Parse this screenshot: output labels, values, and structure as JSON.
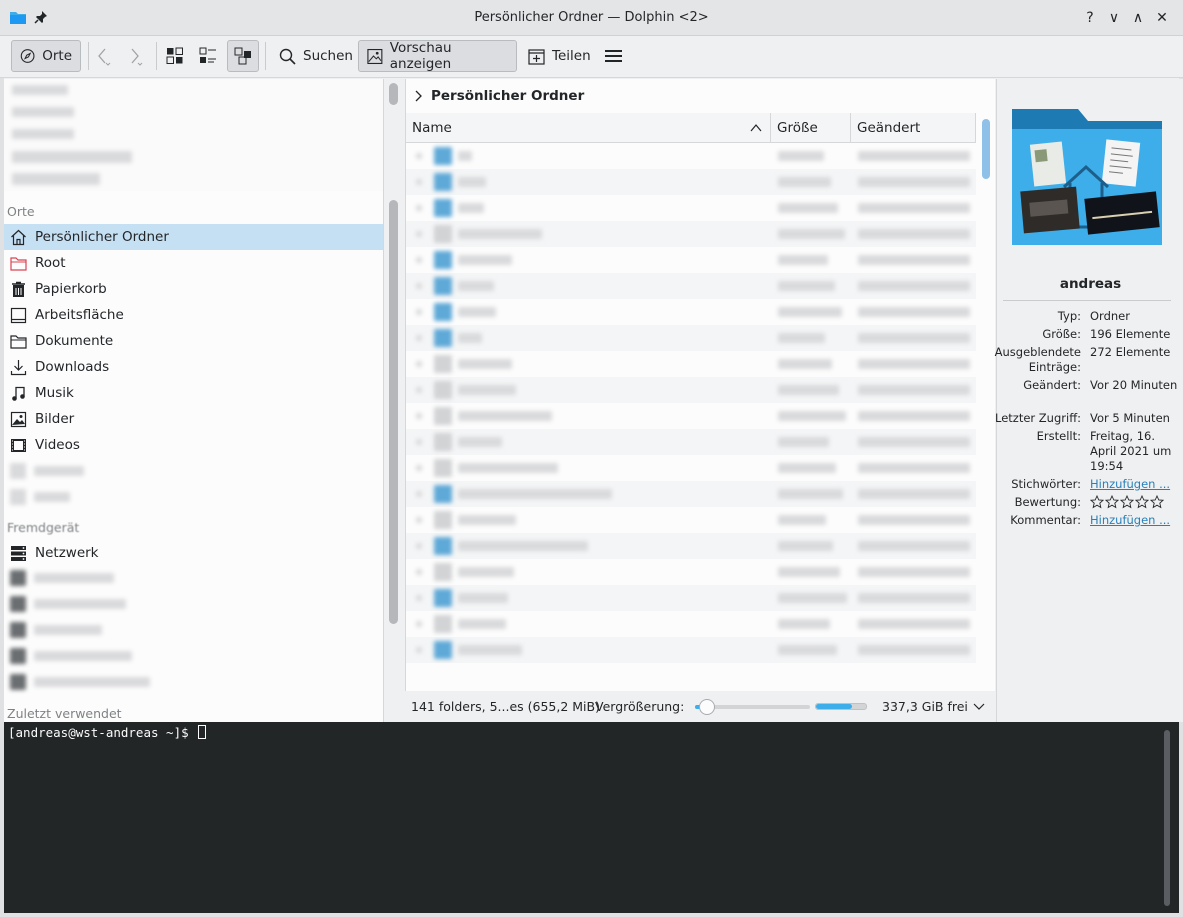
{
  "window": {
    "title": "Persönlicher Ordner — Dolphin <2>",
    "help": "?",
    "controls": [
      "∨",
      "∧",
      "✕"
    ]
  },
  "toolbar": {
    "places_label": "Orte",
    "search_label": "Suchen",
    "preview_label": "Vorschau anzeigen",
    "share_label": "Teilen"
  },
  "places": {
    "section_places": "Orte",
    "items": [
      {
        "label": "Persönlicher Ordner",
        "icon": "home-icon",
        "active": true
      },
      {
        "label": "Root",
        "icon": "root-folder-icon"
      },
      {
        "label": "Papierkorb",
        "icon": "trash-icon"
      },
      {
        "label": "Arbeitsfläche",
        "icon": "desktop-icon"
      },
      {
        "label": "Dokumente",
        "icon": "document-icon"
      },
      {
        "label": "Downloads",
        "icon": "download-icon"
      },
      {
        "label": "Musik",
        "icon": "music-icon"
      },
      {
        "label": "Bilder",
        "icon": "image-icon"
      },
      {
        "label": "Videos",
        "icon": "video-icon"
      }
    ],
    "section_remote": "Fremdgerät",
    "network_label": "Netzwerk",
    "section_recent": "Zuletzt verwendet"
  },
  "main": {
    "breadcrumb": "Persönlicher Ordner",
    "columns": {
      "name": "Name",
      "size": "Größe",
      "modified": "Geändert"
    }
  },
  "status": {
    "summary": "141 folders, 5...es (655,2 MiB)",
    "zoom_label": "Vergrößerung:",
    "free_space": "337,3 GiB frei",
    "zoom_fraction": 0.1,
    "used_fraction": 0.72
  },
  "info": {
    "name": "andreas",
    "fields": [
      {
        "key": "Typ:",
        "value": "Ordner"
      },
      {
        "key": "Größe:",
        "value": "196 Elemente"
      },
      {
        "key": "Ausgeblendete Einträge:",
        "value": "272 Elemente"
      },
      {
        "key": "Geändert:",
        "value": "Vor 20 Minuten"
      },
      {
        "key": "Letzter Zugriff:",
        "value": "Vor 5 Minuten"
      },
      {
        "key": "Erstellt:",
        "value": "Freitag, 16. April 2021 um 19:54"
      },
      {
        "key": "Stichwörter:",
        "value": "Hinzufügen ..."
      },
      {
        "key": "Bewertung:",
        "value": ""
      },
      {
        "key": "Kommentar:",
        "value": "Hinzufügen ..."
      }
    ],
    "rating_stars": 0
  },
  "terminal": {
    "prompt": "[andreas@wst-andreas ~]$ "
  },
  "colors": {
    "accent": "#3daee9",
    "selection": "#c5dff3",
    "terminal_bg": "#232627"
  }
}
